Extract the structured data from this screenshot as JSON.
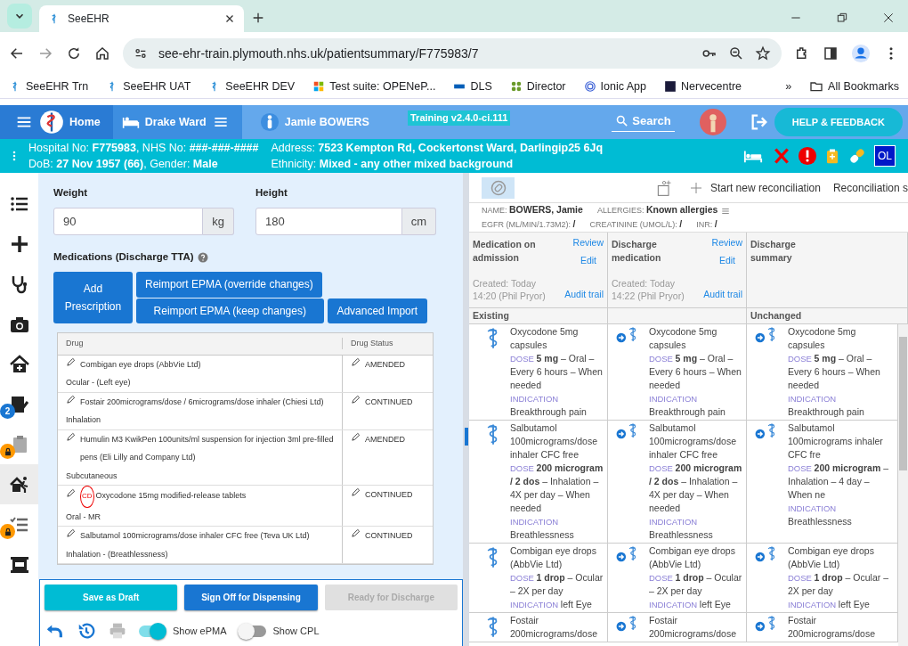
{
  "browser": {
    "tab_title": "SeeEHR",
    "url": "see-ehr-train.plymouth.nhs.uk/patientsummary/F775983/7",
    "bookmarks": [
      {
        "label": "SeeEHR Trn"
      },
      {
        "label": "SeeEHR UAT"
      },
      {
        "label": "SeeEHR DEV"
      },
      {
        "label": "Test suite: OPENeP..."
      },
      {
        "label": "DLS"
      },
      {
        "label": "Director"
      },
      {
        "label": "Ionic App"
      },
      {
        "label": "Nervecentre"
      }
    ],
    "more": "»",
    "all_bookmarks": "All Bookmarks"
  },
  "navbar": {
    "crumbs": [
      {
        "label": "Home"
      },
      {
        "label": "Drake Ward"
      },
      {
        "label": "Jamie BOWERS"
      }
    ],
    "version": "Training v2.4.0-ci.111",
    "search": "Search",
    "help": "HELP & FEEDBACK"
  },
  "banner": {
    "lines": [
      "Hospital No: **F775983**, NHS No: **###-###-####**",
      "Address: **7523 Kempton Rd, Cockertonst Ward, Darlingip25 6Jq**",
      "DoB: **27 Nov 1957 (66)**, Gender: **Male**",
      "Ethnicity: **Mixed - any other mixed background**"
    ],
    "badge": "OL"
  },
  "rail": [
    {
      "selected": false
    },
    {
      "selected": false
    },
    {
      "selected": false
    },
    {
      "selected": false
    },
    {
      "selected": false
    },
    {
      "selected": false,
      "badge": "2"
    },
    {
      "selected": false,
      "locked": true
    },
    {
      "selected": true
    },
    {
      "selected": false,
      "locked": true
    },
    {
      "selected": false
    }
  ],
  "form": {
    "weight": {
      "label": "Weight",
      "value": "90",
      "unit": "kg"
    },
    "height": {
      "label": "Height",
      "value": "180",
      "unit": "cm"
    },
    "section": "Medications (Discharge TTA)",
    "actions": [
      "Add Prescription",
      "Reimport EPMA (override changes)",
      "Reimport EPMA (keep changes)",
      "Advanced Import"
    ],
    "columns": [
      "Drug",
      "Drug Status"
    ],
    "drugs": [
      {
        "name": "Combigan eye drops (AbbVie Ltd)",
        "route": "Ocular - (Left eye)",
        "status": "AMENDED",
        "cd": false
      },
      {
        "name": "Fostair 200micrograms/dose / 6micrograms/dose inhaler (Chiesi Ltd)",
        "route": "Inhalation",
        "status": "CONTINUED",
        "cd": false
      },
      {
        "name": "Humulin M3 KwikPen 100units/ml suspension for injection 3ml pre-filled pens (Eli Lilly and Company Ltd)",
        "route": "Subcutaneous",
        "status": "AMENDED",
        "cd": false
      },
      {
        "name": "Oxycodone 15mg modified-release tablets",
        "route": "Oral - MR",
        "status": "CONTINUED",
        "cd": true,
        "cd_label": "CD"
      },
      {
        "name": "Salbutamol 100micrograms/dose inhaler CFC free (Teva UK Ltd)",
        "route": "Inhalation - (Breathlessness)",
        "status": "CONTINUED",
        "cd": false
      }
    ],
    "buttons": [
      {
        "label": "Save as Draft",
        "kind": "info",
        "disabled": false
      },
      {
        "label": "Sign Off for Dispensing",
        "kind": "primary",
        "disabled": false
      },
      {
        "label": "Ready for Discharge",
        "kind": "plain",
        "disabled": true
      }
    ],
    "toggles": [
      {
        "label": "Show ePMA",
        "on": true
      },
      {
        "label": "Show CPL",
        "on": false
      }
    ]
  },
  "recon": {
    "start": "Start new reconciliation",
    "other": "Reconciliation s",
    "info": [
      "NAME: **BOWERS, Jamie**",
      "ALLERGIES: **Known allergies**",
      "EGFR (ML/MIN/1.73M2): **/**",
      "CREATININE (UMOL/L): **/**",
      "INR: **/**"
    ],
    "columns": [
      {
        "title": "Medication on admission",
        "review": "Review",
        "edit": "Edit",
        "created": "Created: Today 14:20 (Phil Pryor)",
        "audit": "Audit trail",
        "section": "Existing"
      },
      {
        "title": "Discharge medication",
        "review": "Review",
        "edit": "Edit",
        "created": "Created: Today 14:22 (Phil Pryor)",
        "audit": "Audit trail"
      },
      {
        "title": "Discharge summary",
        "section": "Unchanged"
      }
    ],
    "rows": [
      [
        {
          "arrow": false,
          "name": "Oxycodone 5mg capsules",
          "dose_label": "DOSE",
          "dose": "**5 mg** – Oral – Every 6 hours – When needed",
          "indication_label": "INDICATION",
          "indication": "Breakthrough pain"
        },
        {
          "arrow": true,
          "name": "Oxycodone 5mg capsules",
          "dose_label": "DOSE",
          "dose": "**5 mg** – Oral – Every 6 hours – When needed",
          "indication_label": "INDICATION",
          "indication": "Breakthrough pain"
        },
        {
          "arrow": true,
          "name": "Oxycodone 5mg capsules",
          "dose_label": "DOSE",
          "dose": "**5 mg** – Oral – Every 6 hours – When needed",
          "indication_label": "INDICATION",
          "indication": "Breakthrough pain"
        }
      ],
      [
        {
          "arrow": false,
          "name": "Salbutamol 100micrograms/dose inhaler CFC free",
          "dose_label": "DOSE",
          "dose": "**200 microgram / 2 dos** – Inhalation – 4X per day – When needed",
          "indication_label": "INDICATION",
          "indication": "Breathlessness"
        },
        {
          "arrow": true,
          "name": "Salbutamol 100micrograms/dose inhaler CFC free",
          "dose_label": "DOSE",
          "dose": "**200 microgram / 2 dos** – Inhalation – 4X per day – When needed",
          "indication_label": "INDICATION",
          "indication": "Breathlessness"
        },
        {
          "arrow": true,
          "name": "Salbutamol 100micrograms inhaler CFC fre",
          "dose_label": "DOSE",
          "dose": "**200 microgram** – Inhalation – 4 day – When ne",
          "indication_label": "INDICATION",
          "indication": "Breathlessness"
        }
      ],
      [
        {
          "arrow": false,
          "name": "Combigan eye drops (AbbVie Ltd)",
          "dose_label": "DOSE",
          "dose": "**1 drop** – Ocular – 2X per day",
          "indication_label": "INDICATION",
          "indication": "left Eye"
        },
        {
          "arrow": true,
          "name": "Combigan eye drops (AbbVie Ltd)",
          "dose_label": "DOSE",
          "dose": "**1 drop** – Ocular – 2X per day",
          "indication_label": "INDICATION",
          "indication": "left Eye"
        },
        {
          "arrow": true,
          "name": "Combigan eye drops (AbbVie Ltd)",
          "dose_label": "DOSE",
          "dose": "**1 drop** – Ocular – 2X per day",
          "indication_label": "INDICATION",
          "indication": "left Eye"
        }
      ],
      [
        {
          "arrow": false,
          "name": "Fostair 200micrograms/dose"
        },
        {
          "arrow": true,
          "name": "Fostair 200micrograms/dose"
        },
        {
          "arrow": true,
          "name": "Fostair 200micrograms/dose"
        }
      ]
    ]
  }
}
